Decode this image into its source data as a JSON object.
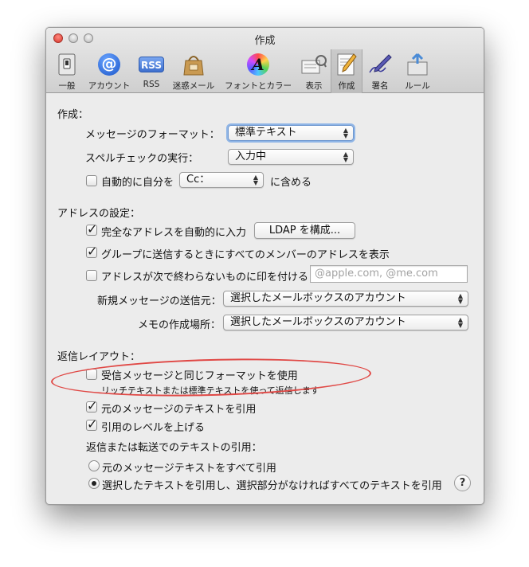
{
  "window": {
    "title": "作成"
  },
  "toolbar": {
    "items": [
      {
        "label": "一般"
      },
      {
        "label": "アカウント",
        "icon_text": "@"
      },
      {
        "label": "RSS",
        "icon_text": "RSS"
      },
      {
        "label": "迷惑メール"
      },
      {
        "label": "フォントとカラー",
        "icon_text": "A"
      },
      {
        "label": "表示"
      },
      {
        "label": "作成"
      },
      {
        "label": "署名"
      },
      {
        "label": "ルール"
      }
    ],
    "selected": "作成"
  },
  "compose": {
    "heading": "作成：",
    "format_label": "メッセージのフォーマット：",
    "format_value": "標準テキスト",
    "spell_label": "スペルチェックの実行：",
    "spell_value": "入力中",
    "auto_self_label": "自動的に自分を",
    "auto_self_checked": false,
    "cc_value": "Cc：",
    "include_label": "に含める"
  },
  "address": {
    "heading": "アドレスの設定：",
    "autocomplete_label": "完全なアドレスを自動的に入力",
    "autocomplete_checked": true,
    "ldap_button": "LDAP を構成...",
    "group_label": "グループに送信するときにすべてのメンバーのアドレスを表示",
    "group_checked": true,
    "mark_label": "アドレスが次で終わらないものに印を付ける",
    "mark_checked": false,
    "domain_placeholder": "@apple.com, @me.com",
    "send_from_label": "新規メッセージの送信元：",
    "send_from_value": "選択したメールボックスのアカウント",
    "notes_label": "メモの作成場所：",
    "notes_value": "選択したメールボックスのアカウント"
  },
  "reply": {
    "heading": "返信レイアウト：",
    "same_format_label": "受信メッセージと同じフォーマットを使用",
    "same_format_checked": false,
    "same_format_hint": "リッチテキストまたは標準テキストを使って返信します",
    "quote_label": "元のメッセージのテキストを引用",
    "quote_checked": true,
    "increase_level_label": "引用のレベルを上げる",
    "increase_level_checked": true,
    "quoting_heading": "返信または転送でのテキストの引用：",
    "radio_all_label": "元のメッセージテキストをすべて引用",
    "radio_selected_label": "選択したテキストを引用し、選択部分がなければすべてのテキストを引用",
    "selected_option": "radio_selected"
  },
  "help_button": "?",
  "colors": {
    "annotation": "#e04845",
    "accent": "#6d96cf"
  }
}
